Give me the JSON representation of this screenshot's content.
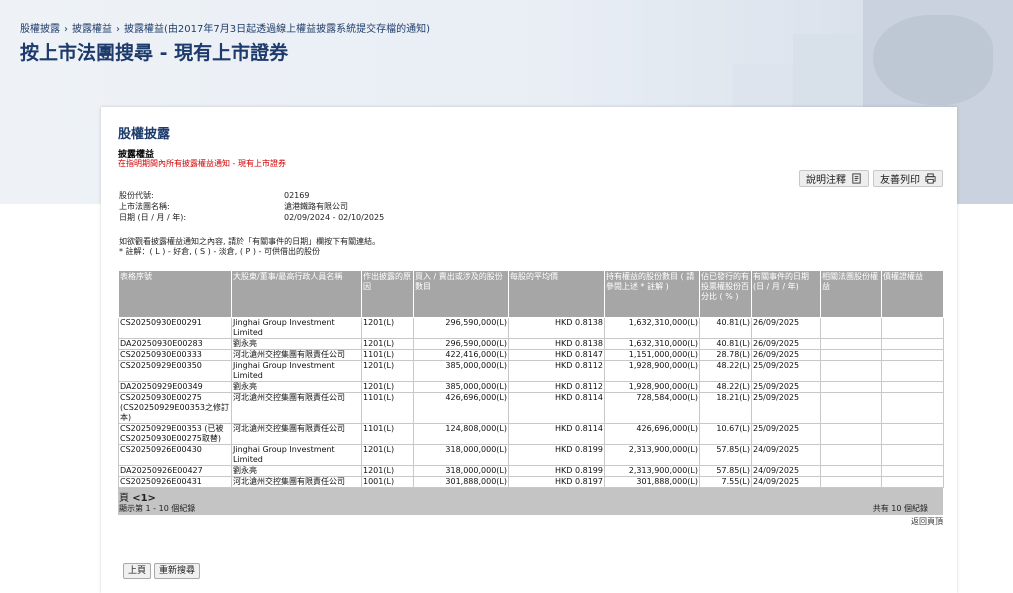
{
  "breadcrumb": [
    "股權披露",
    "披露權益",
    "披露權益(由2017年7月3日起透過線上權益披露系統提交存檔的通知)"
  ],
  "page_title": "按上市法團搜尋 - 現有上市證券",
  "panel": {
    "section_title": "股權披露",
    "sub_title": "披露權益",
    "sub_note": "在指明期間內所有披露權益通知 - 現有上市證券",
    "buttons": {
      "explain": "說明注釋",
      "print": "友善列印"
    },
    "meta": [
      {
        "label": "股份代號:",
        "value": "02169"
      },
      {
        "label": "上市法團名稱:",
        "value": "滄港鐵路有限公司"
      },
      {
        "label": "日期 (日 / 月 / 年):",
        "value": "02/09/2024 - 02/10/2025"
      }
    ],
    "instructions": [
      "如欲觀看披露權益通知之內容, 請於「有關事件的日期」欄按下有關連結。",
      "* 註解：(  L  ) - 好倉, (  S  ) - 淡倉, (  P  ) - 可供借出的股份"
    ]
  },
  "table": {
    "headers": [
      "表格序號",
      "大股東/董事/最高行政人員名稱",
      "作出披露的原因",
      "買入 / 賣出或涉及的股份數目",
      "每股的平均價",
      "持有權益的股份數目 ( 請參閱上述 * 註解 )",
      "佔已發行的有投票權股份百分比 ( % )",
      "有關事件的日期 (日 / 月 / 年)",
      "相關法團股份權益",
      "債權證權益"
    ],
    "rows": [
      [
        "CS20250930E00291",
        "Jinghai Group Investment Limited",
        "1201(L)",
        "296,590,000(L)",
        "HKD 0.8138",
        "1,632,310,000(L)",
        "40.81(L)",
        "26/09/2025",
        "",
        ""
      ],
      [
        "DA20250930E00283",
        "劉永亮",
        "1201(L)",
        "296,590,000(L)",
        "HKD 0.8138",
        "1,632,310,000(L)",
        "40.81(L)",
        "26/09/2025",
        "",
        ""
      ],
      [
        "CS20250930E00333",
        "河北滄州交控集團有限責任公司",
        "1101(L)",
        "422,416,000(L)",
        "HKD 0.8147",
        "1,151,000,000(L)",
        "28.78(L)",
        "26/09/2025",
        "",
        ""
      ],
      [
        "CS20250929E00350",
        "Jinghai Group Investment Limited",
        "1201(L)",
        "385,000,000(L)",
        "HKD 0.8112",
        "1,928,900,000(L)",
        "48.22(L)",
        "25/09/2025",
        "",
        ""
      ],
      [
        "DA20250929E00349",
        "劉永亮",
        "1201(L)",
        "385,000,000(L)",
        "HKD 0.8112",
        "1,928,900,000(L)",
        "48.22(L)",
        "25/09/2025",
        "",
        ""
      ],
      [
        "CS20250930E00275 (CS20250929E00353之修訂本)",
        "河北滄州交控集團有限責任公司",
        "1101(L)",
        "426,696,000(L)",
        "HKD 0.8114",
        "728,584,000(L)",
        "18.21(L)",
        "25/09/2025",
        "",
        ""
      ],
      [
        "CS20250929E00353 (已被CS20250930E00275取替)",
        "河北滄州交控集團有限責任公司",
        "1101(L)",
        "124,808,000(L)",
        "HKD 0.8114",
        "426,696,000(L)",
        "10.67(L)",
        "25/09/2025",
        "",
        ""
      ],
      [
        "CS20250926E00430",
        "Jinghai Group Investment Limited",
        "1201(L)",
        "318,000,000(L)",
        "HKD 0.8199",
        "2,313,900,000(L)",
        "57.85(L)",
        "24/09/2025",
        "",
        ""
      ],
      [
        "DA20250926E00427",
        "劉永亮",
        "1201(L)",
        "318,000,000(L)",
        "HKD 0.8199",
        "2,313,900,000(L)",
        "57.85(L)",
        "24/09/2025",
        "",
        ""
      ],
      [
        "CS20250926E00431",
        "河北滄州交控集團有限責任公司",
        "1001(L)",
        "301,888,000(L)",
        "HKD 0.8197",
        "301,888,000(L)",
        "7.55(L)",
        "24/09/2025",
        "",
        ""
      ]
    ],
    "pager": {
      "label": "頁",
      "current": "<1>",
      "shown": "顯示第 1 - 10 個紀錄",
      "total": "共有 10 個紀錄"
    },
    "back_to_top": "返回頁頂"
  },
  "bottom_buttons": {
    "prev": "上頁",
    "new_search": "重新搜尋"
  },
  "colors": {
    "title": "#1c3a6b",
    "note": "#d00000",
    "header_bg": "#a6a6a6",
    "pager_bg": "#c4c4c4"
  },
  "icons": {
    "explain": "document-icon",
    "print": "printer-icon"
  }
}
